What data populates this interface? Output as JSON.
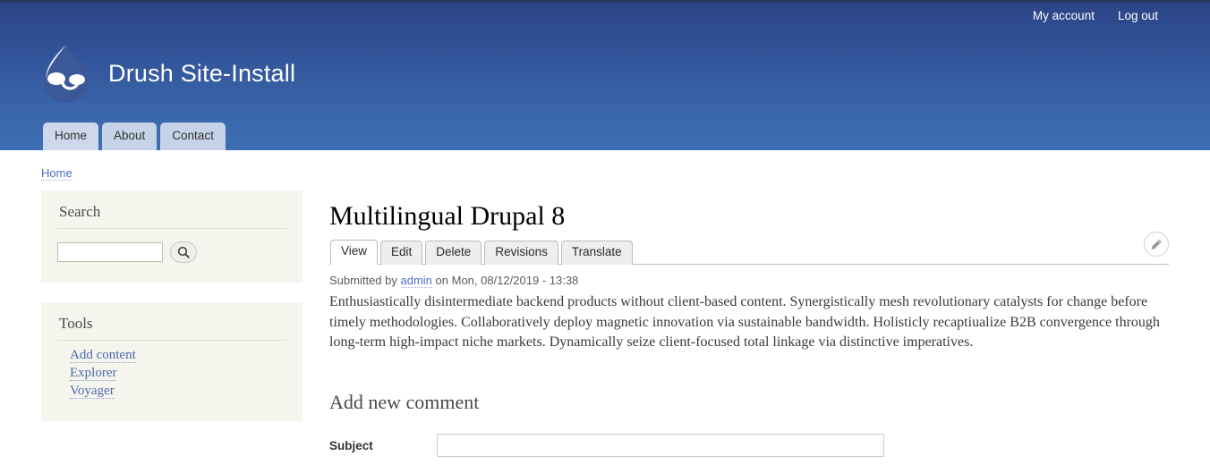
{
  "header": {
    "site_name": "Drush Site-Install",
    "logo_icon": "drupal-droplet-icon",
    "user_menu": [
      {
        "label": "My account"
      },
      {
        "label": "Log out"
      }
    ],
    "nav": [
      {
        "label": "Home",
        "active": true
      },
      {
        "label": "About",
        "active": false
      },
      {
        "label": "Contact",
        "active": false
      }
    ],
    "colors": {
      "gradient_top": "#2c4485",
      "gradient_bottom": "#3d6eb4",
      "topline": "#27365f",
      "nav_tab_bg": "#c5d2e7"
    }
  },
  "breadcrumb": {
    "items": [
      {
        "label": "Home"
      }
    ]
  },
  "sidebar": {
    "search_block": {
      "title": "Search",
      "input_value": "",
      "input_placeholder": "",
      "button_icon": "search-icon"
    },
    "tools_block": {
      "title": "Tools",
      "links": [
        {
          "label": "Add content"
        },
        {
          "label": "Explorer"
        },
        {
          "label": "Voyager"
        }
      ]
    },
    "colors": {
      "block_bg": "#f4f6ee",
      "link": "#5066ad"
    }
  },
  "main": {
    "node_title": "Multilingual Drupal 8",
    "tabs": [
      {
        "label": "View",
        "active": true
      },
      {
        "label": "Edit",
        "active": false
      },
      {
        "label": "Delete",
        "active": false
      },
      {
        "label": "Revisions",
        "active": false
      },
      {
        "label": "Translate",
        "active": false
      }
    ],
    "contextual_icon": "pencil-icon",
    "submitted": {
      "prefix": "Submitted by",
      "author": "admin",
      "suffix": "on Mon, 08/12/2019 - 13:38"
    },
    "body_text": "Enthusiastically disintermediate backend products without client-based content. Synergistically mesh revolutionary catalysts for change before timely methodologies. Collaboratively deploy magnetic innovation via sustainable bandwidth. Holisticly recaptiualize B2B convergence through long-term high-impact niche markets. Dynamically seize client-focused total linkage via distinctive imperatives.",
    "comment_form": {
      "heading": "Add new comment",
      "subject_label": "Subject",
      "subject_value": "",
      "subject_placeholder": ""
    }
  }
}
